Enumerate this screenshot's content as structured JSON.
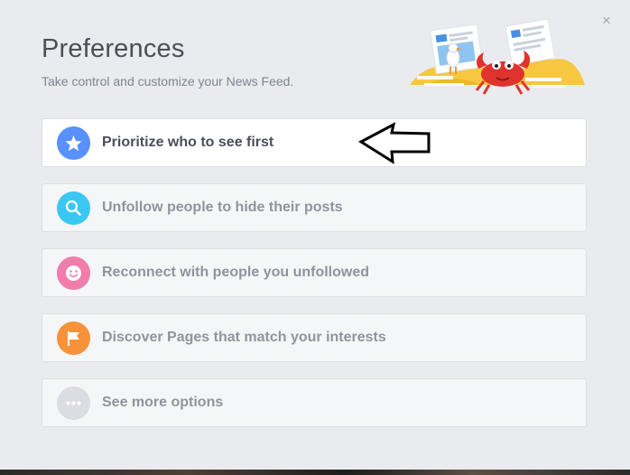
{
  "dialog": {
    "title": "Preferences",
    "subtitle": "Take control and customize your News Feed.",
    "close_label": "×"
  },
  "options": [
    {
      "label": "Prioritize who to see first",
      "icon": "star-icon",
      "color": "#5890ff",
      "active": true
    },
    {
      "label": "Unfollow people to hide their posts",
      "icon": "search-icon",
      "color": "#3ac8f3",
      "active": false
    },
    {
      "label": "Reconnect with people you unfollowed",
      "icon": "smiley-icon",
      "color": "#f07dab",
      "active": false
    },
    {
      "label": "Discover Pages that match your interests",
      "icon": "flag-icon",
      "color": "#f7923b",
      "active": false
    },
    {
      "label": "See more options",
      "icon": "more-icon",
      "color": "#dadde1",
      "active": false
    }
  ],
  "colors": {
    "background": "#e9ebee",
    "title": "#4b4f56",
    "muted_text": "#90949c"
  }
}
